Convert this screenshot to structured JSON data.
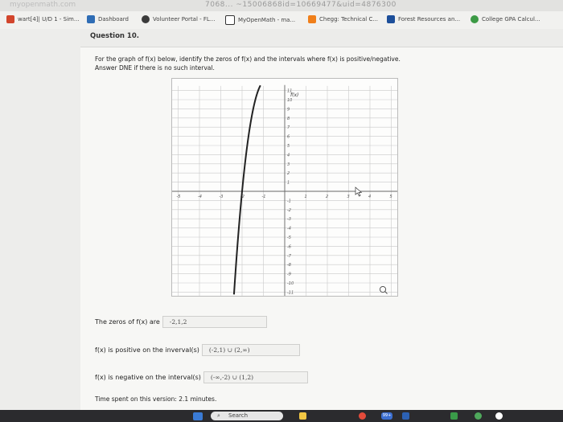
{
  "browser": {
    "url_fragment": "7068... ~15006868id=10669477&uid=4876300",
    "bookmarks": [
      {
        "label": "wart[4]| U/D 1 - Sim...",
        "color": "#d2452c"
      },
      {
        "label": "Dashboard",
        "color": "#2f6db5"
      },
      {
        "label": "Volunteer Portal - FL...",
        "color": "#3b3b3b"
      },
      {
        "label": "MyOpenMath - ma...",
        "color": "#333333"
      },
      {
        "label": "Chegg: Technical C...",
        "color": "#f07f1a"
      },
      {
        "label": "Forest Resources an...",
        "color": "#1d4f9a"
      },
      {
        "label": "College GPA Calcul...",
        "color": "#3c9a45"
      }
    ]
  },
  "question": {
    "title": "Question 10.",
    "prompt_line1": "For the graph of f(x) below, identify the zeros of f(x) and the intervals where f(x) is positive/negative.",
    "prompt_line2": "Answer DNE if there is no such interval."
  },
  "graph": {
    "function_label": "f(x)",
    "x_tick_labels": [
      "-5",
      "-4",
      "-3",
      "-2",
      "-1",
      "1",
      "2",
      "3",
      "4",
      "5"
    ],
    "y_tick_labels": [
      "11",
      "10",
      "9",
      "8",
      "7",
      "6",
      "5",
      "4",
      "3",
      "2",
      "1",
      "-1",
      "-2",
      "-3",
      "-4",
      "-5",
      "-6",
      "-7",
      "-8",
      "-9",
      "-10",
      "-11"
    ]
  },
  "answers": {
    "zeros_label": "The zeros of f(x) are",
    "zeros_value": "-2,1,2",
    "positive_label": "f(x) is positive on the inverval(s)",
    "positive_value": "(-2,1) ∪ (2,∞)",
    "negative_label": "f(x) is negative on the interval(s)",
    "negative_value": "(-∞,-2) ∪ (1,2)"
  },
  "footer": {
    "time_text": "Time spent on this version: 2.1 minutes."
  },
  "taskbar": {
    "search_label": "Search",
    "badge": "99+"
  }
}
